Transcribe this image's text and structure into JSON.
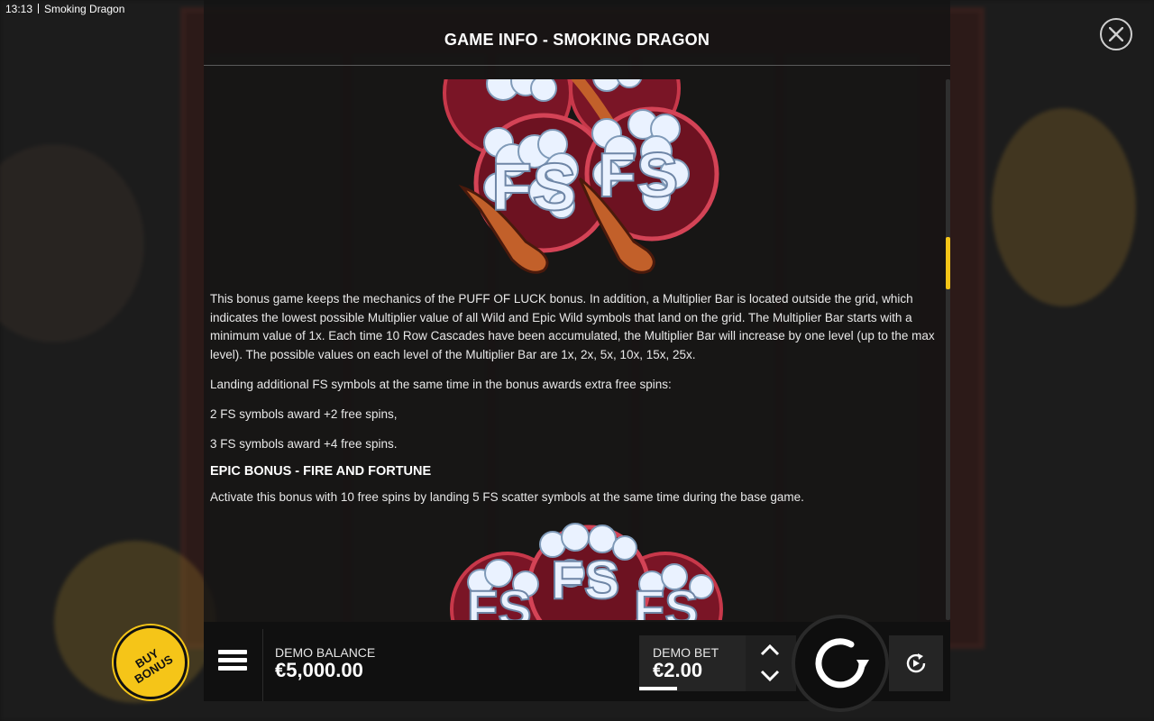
{
  "status_bar": {
    "time": "13:13",
    "app_title": "Smoking Dragon"
  },
  "info": {
    "title": "GAME INFO - SMOKING DRAGON",
    "close_icon": "close-icon",
    "paragraphs": [
      "This bonus game keeps the mechanics of the PUFF OF LUCK bonus. In addition, a Multiplier Bar is located outside the grid, which indicates the lowest possible Multiplier value of all Wild and Epic Wild symbols that land on the grid. The Multiplier Bar starts with a minimum value of 1x. Each time 10 Row Cascades have been accumulated, the Multiplier Bar will increase by one level (up to the max level). The possible values on each level of the Multiplier Bar are 1x, 2x, 5x, 10x, 15x, 25x.",
      "Landing additional FS symbols at the same time in the bonus awards extra free spins:",
      "2 FS symbols award +2 free spins,",
      "3 FS symbols award +4 free spins."
    ],
    "section_heading": "EPIC BONUS - FIRE AND FORTUNE",
    "section_paragraph": "Activate this bonus with 10 free spins by landing 5 FS scatter symbols at the same time during the base game.",
    "symbol_letters": "FS"
  },
  "hud": {
    "buy_bonus_label": "BUY BONUS",
    "menu_icon": "hamburger-menu-icon",
    "balance_label": "DEMO BALANCE",
    "balance_value": "€5,000.00",
    "bet_label": "DEMO BET",
    "bet_value": "€2.00",
    "spin_icon": "spin-icon",
    "autoplay_icon": "autoplay-icon"
  },
  "colors": {
    "accent": "#f5c518",
    "panel": "#141414",
    "symbol_red": "#7a1526",
    "symbol_pipe": "#c2602a",
    "cloud": "#eaf2ff"
  }
}
